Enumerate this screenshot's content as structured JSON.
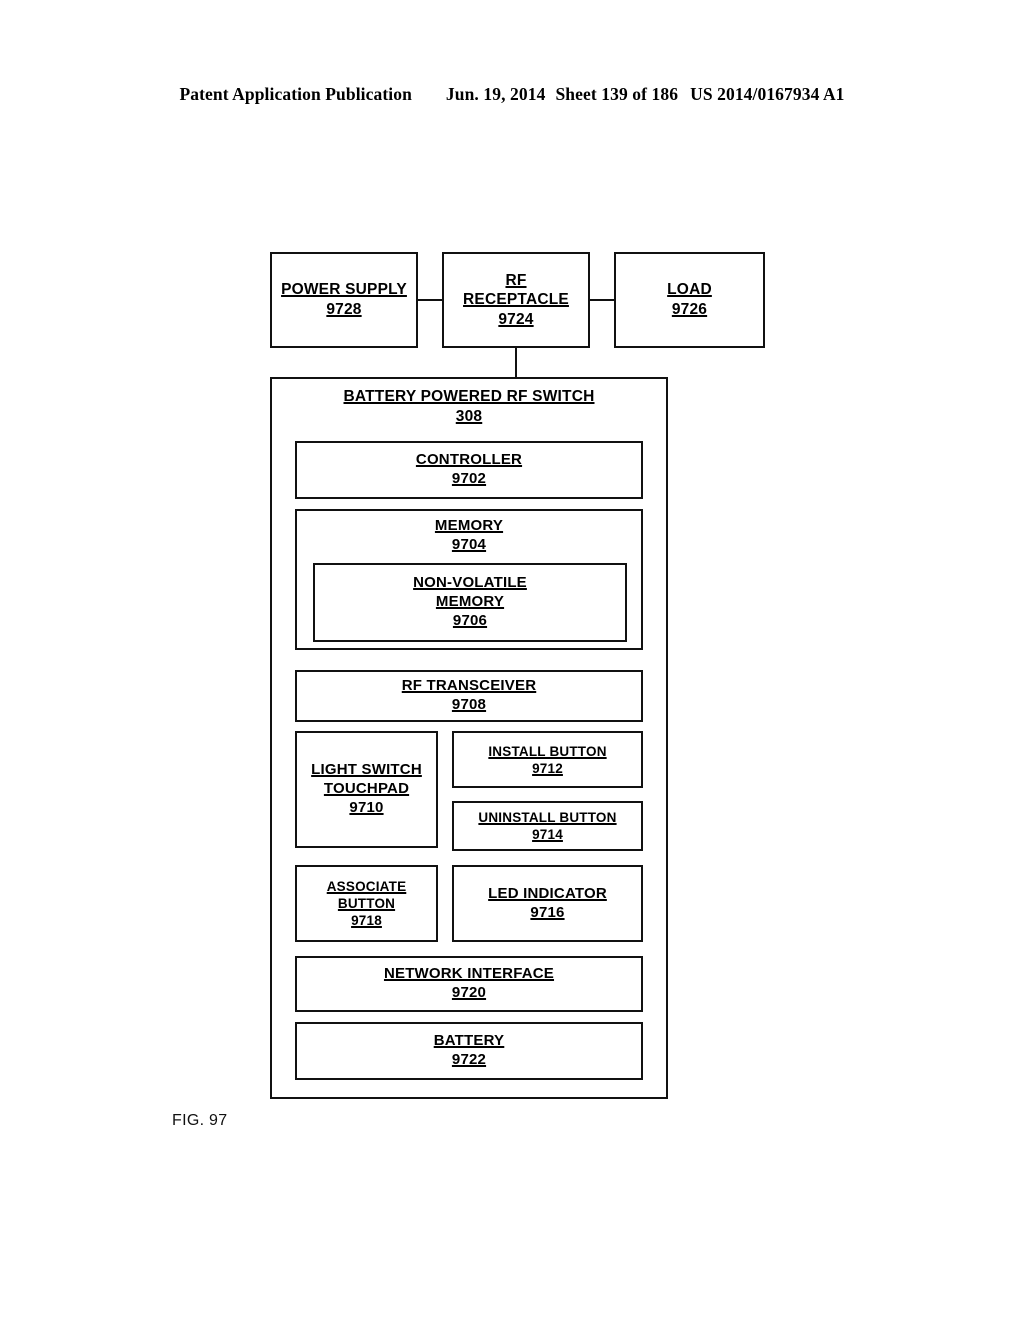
{
  "header": {
    "publication": "Patent Application Publication",
    "date": "Jun. 19, 2014",
    "sheet": "Sheet 139 of 186",
    "patent_number": "US 2014/0167934 A1"
  },
  "figure": {
    "caption": "FIG. 97",
    "top_row": [
      {
        "title": "POWER SUPPLY",
        "ref": "9728"
      },
      {
        "title_line1": "RF",
        "title_line2": "RECEPTACLE",
        "ref": "9724"
      },
      {
        "title": "LOAD",
        "ref": "9726"
      }
    ],
    "container": {
      "title": "BATTERY POWERED RF SWITCH",
      "ref": "308"
    },
    "blocks": {
      "controller": {
        "title": "CONTROLLER",
        "ref": "9702"
      },
      "memory": {
        "title": "MEMORY",
        "ref": "9704"
      },
      "nonvolatile_memory": {
        "title_line1": "NON-VOLATILE",
        "title_line2": "MEMORY",
        "ref": "9706"
      },
      "rf_transceiver": {
        "title": "RF TRANSCEIVER",
        "ref": "9708"
      },
      "light_switch_touchpad": {
        "title_line1": "LIGHT SWITCH",
        "title_line2": "TOUCHPAD",
        "ref": "9710"
      },
      "install_button": {
        "title": "INSTALL BUTTON",
        "ref": "9712"
      },
      "uninstall_button": {
        "title": "UNINSTALL BUTTON",
        "ref": "9714"
      },
      "associate_button": {
        "title_line1": "ASSOCIATE",
        "title_line2": "BUTTON",
        "ref": "9718"
      },
      "led_indicator": {
        "title": "LED INDICATOR",
        "ref": "9716"
      },
      "network_interface": {
        "title": "NETWORK INTERFACE",
        "ref": "9720"
      },
      "battery": {
        "title": "BATTERY",
        "ref": "9722"
      }
    }
  },
  "colors": {
    "ink": "#111111",
    "page": "#ffffff"
  }
}
